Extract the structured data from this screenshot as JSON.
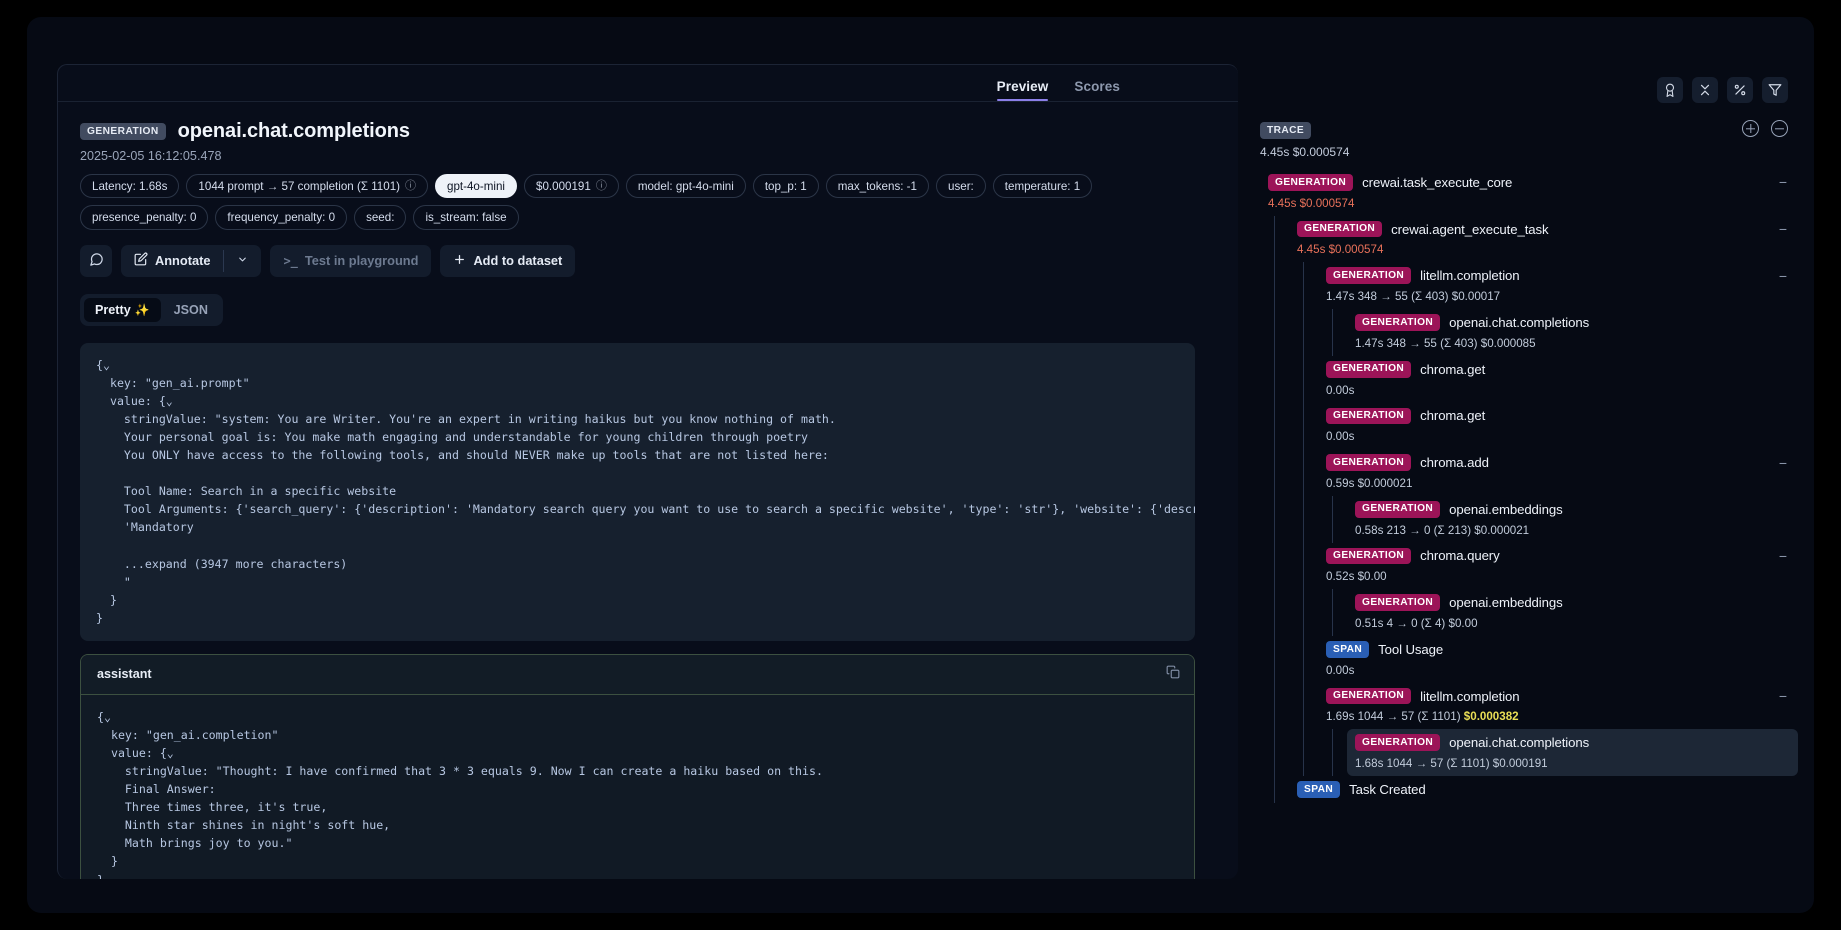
{
  "tabs": [
    {
      "label": "Preview",
      "active": true
    },
    {
      "label": "Scores",
      "active": false
    }
  ],
  "observation": {
    "type_chip": "GENERATION",
    "title": "openai.chat.completions",
    "timestamp": "2025-02-05 16:12:05.478",
    "badges": [
      {
        "label": "Latency: 1.68s",
        "info": false,
        "solid": false
      },
      {
        "label": "1044 prompt → 57 completion (Σ 1101)",
        "info": true,
        "solid": false
      },
      {
        "label": "gpt-4o-mini",
        "info": false,
        "solid": true
      },
      {
        "label": "$0.000191",
        "info": true,
        "solid": false
      },
      {
        "label": "model: gpt-4o-mini",
        "info": false,
        "solid": false
      },
      {
        "label": "top_p: 1",
        "info": false,
        "solid": false
      },
      {
        "label": "max_tokens: -1",
        "info": false,
        "solid": false
      },
      {
        "label": "user:",
        "info": false,
        "solid": false
      },
      {
        "label": "temperature: 1",
        "info": false,
        "solid": false
      },
      {
        "label": "presence_penalty: 0",
        "info": false,
        "solid": false
      },
      {
        "label": "frequency_penalty: 0",
        "info": false,
        "solid": false
      },
      {
        "label": "seed:",
        "info": false,
        "solid": false
      },
      {
        "label": "is_stream: false",
        "info": false,
        "solid": false
      }
    ],
    "actions": {
      "comment_icon": "comment-icon",
      "annotate_label": "Annotate",
      "annotate_icon": "pencil-square-icon",
      "annotate_caret": "⌄",
      "playground_label": "Test in playground",
      "playground_icon": ">_",
      "dataset_label": "Add to dataset",
      "dataset_icon": "+"
    },
    "view_toggle": [
      {
        "label": "Pretty",
        "sparkle": "✨",
        "active": true
      },
      {
        "label": "JSON",
        "sparkle": "",
        "active": false
      }
    ],
    "prompt_block": "{⌄\n  key: \"gen_ai.prompt\"\n  value: {⌄\n    stringValue: \"system: You are Writer. You're an expert in writing haikus but you know nothing of math.\n    Your personal goal is: You make math engaging and understandable for young children through poetry\n    You ONLY have access to the following tools, and should NEVER make up tools that are not listed here:\n\n    Tool Name: Search in a specific website\n    Tool Arguments: {'search_query': {'description': 'Mandatory search query you want to use to search a specific website', 'type': 'str'}, 'website': {'description':\n    'Mandatory\n\n    ...expand (3947 more characters)\n    \"\n  }\n}",
    "completion_role": "assistant",
    "copy_icon": "copy-icon",
    "completion_block": "{⌄\n  key: \"gen_ai.completion\"\n  value: {⌄\n    stringValue: \"Thought: I have confirmed that 3 * 3 equals 9. Now I can create a haiku based on this.\n    Final Answer:\n    Three times three, it's true,\n    Ninth star shines in night's soft hue,\n    Math brings joy to you.\"\n  }\n}"
  },
  "trace": {
    "toolbar_icons": [
      "award-icon",
      "collapse-icon",
      "percent-icon",
      "filter-icon"
    ],
    "chip": "TRACE",
    "zoom_in_icon": "zoom-in-icon",
    "zoom_out_icon": "zoom-out-icon",
    "root_stats": "4.45s  $0.000574",
    "nodes": [
      {
        "chip": "GENERATION",
        "chip_type": "generation",
        "name": "crewai.task_execute_core",
        "stats": "4.45s  $0.000574",
        "stats_style": "red",
        "collapse": "−",
        "depth": 0,
        "selected": false
      },
      {
        "chip": "GENERATION",
        "chip_type": "generation",
        "name": "crewai.agent_execute_task",
        "stats": "4.45s  $0.000574",
        "stats_style": "red",
        "collapse": "−",
        "depth": 1,
        "selected": false
      },
      {
        "chip": "GENERATION",
        "chip_type": "generation",
        "name": "litellm.completion",
        "stats": "1.47s  348 → 55 (Σ 403)  $0.00017",
        "stats_style": "",
        "collapse": "−",
        "depth": 2,
        "selected": false
      },
      {
        "chip": "GENERATION",
        "chip_type": "generation",
        "name": "openai.chat.completions",
        "stats": "1.47s  348 → 55 (Σ 403)  $0.000085",
        "stats_style": "",
        "collapse": "",
        "depth": 3,
        "selected": false
      },
      {
        "chip": "GENERATION",
        "chip_type": "generation",
        "name": "chroma.get",
        "stats": "0.00s",
        "stats_style": "",
        "collapse": "",
        "depth": 2,
        "selected": false
      },
      {
        "chip": "GENERATION",
        "chip_type": "generation",
        "name": "chroma.get",
        "stats": "0.00s",
        "stats_style": "",
        "collapse": "",
        "depth": 2,
        "selected": false
      },
      {
        "chip": "GENERATION",
        "chip_type": "generation",
        "name": "chroma.add",
        "stats": "0.59s  $0.000021",
        "stats_style": "",
        "collapse": "−",
        "depth": 2,
        "selected": false
      },
      {
        "chip": "GENERATION",
        "chip_type": "generation",
        "name": "openai.embeddings",
        "stats": "0.58s  213 → 0 (Σ 213)  $0.000021",
        "stats_style": "",
        "collapse": "",
        "depth": 3,
        "selected": false
      },
      {
        "chip": "GENERATION",
        "chip_type": "generation",
        "name": "chroma.query",
        "stats": "0.52s  $0.00",
        "stats_style": "",
        "collapse": "−",
        "depth": 2,
        "selected": false
      },
      {
        "chip": "GENERATION",
        "chip_type": "generation",
        "name": "openai.embeddings",
        "stats": "0.51s  4 → 0 (Σ 4)  $0.00",
        "stats_style": "",
        "collapse": "",
        "depth": 3,
        "selected": false
      },
      {
        "chip": "SPAN",
        "chip_type": "span",
        "name": "Tool Usage",
        "stats": "0.00s",
        "stats_style": "",
        "collapse": "",
        "depth": 2,
        "selected": false
      },
      {
        "chip": "GENERATION",
        "chip_type": "generation",
        "name": "litellm.completion",
        "stats": "1.69s  1044 → 57 (Σ 1101)  $0.000382",
        "stats_style": "cost-hl",
        "collapse": "−",
        "depth": 2,
        "selected": false
      },
      {
        "chip": "GENERATION",
        "chip_type": "generation",
        "name": "openai.chat.completions",
        "stats": "1.68s  1044 → 57 (Σ 1101)  $0.000191",
        "stats_style": "",
        "collapse": "",
        "depth": 3,
        "selected": true
      },
      {
        "chip": "SPAN",
        "chip_type": "span",
        "name": "Task Created",
        "stats": "",
        "stats_style": "",
        "collapse": "",
        "depth": 1,
        "selected": false
      }
    ]
  }
}
